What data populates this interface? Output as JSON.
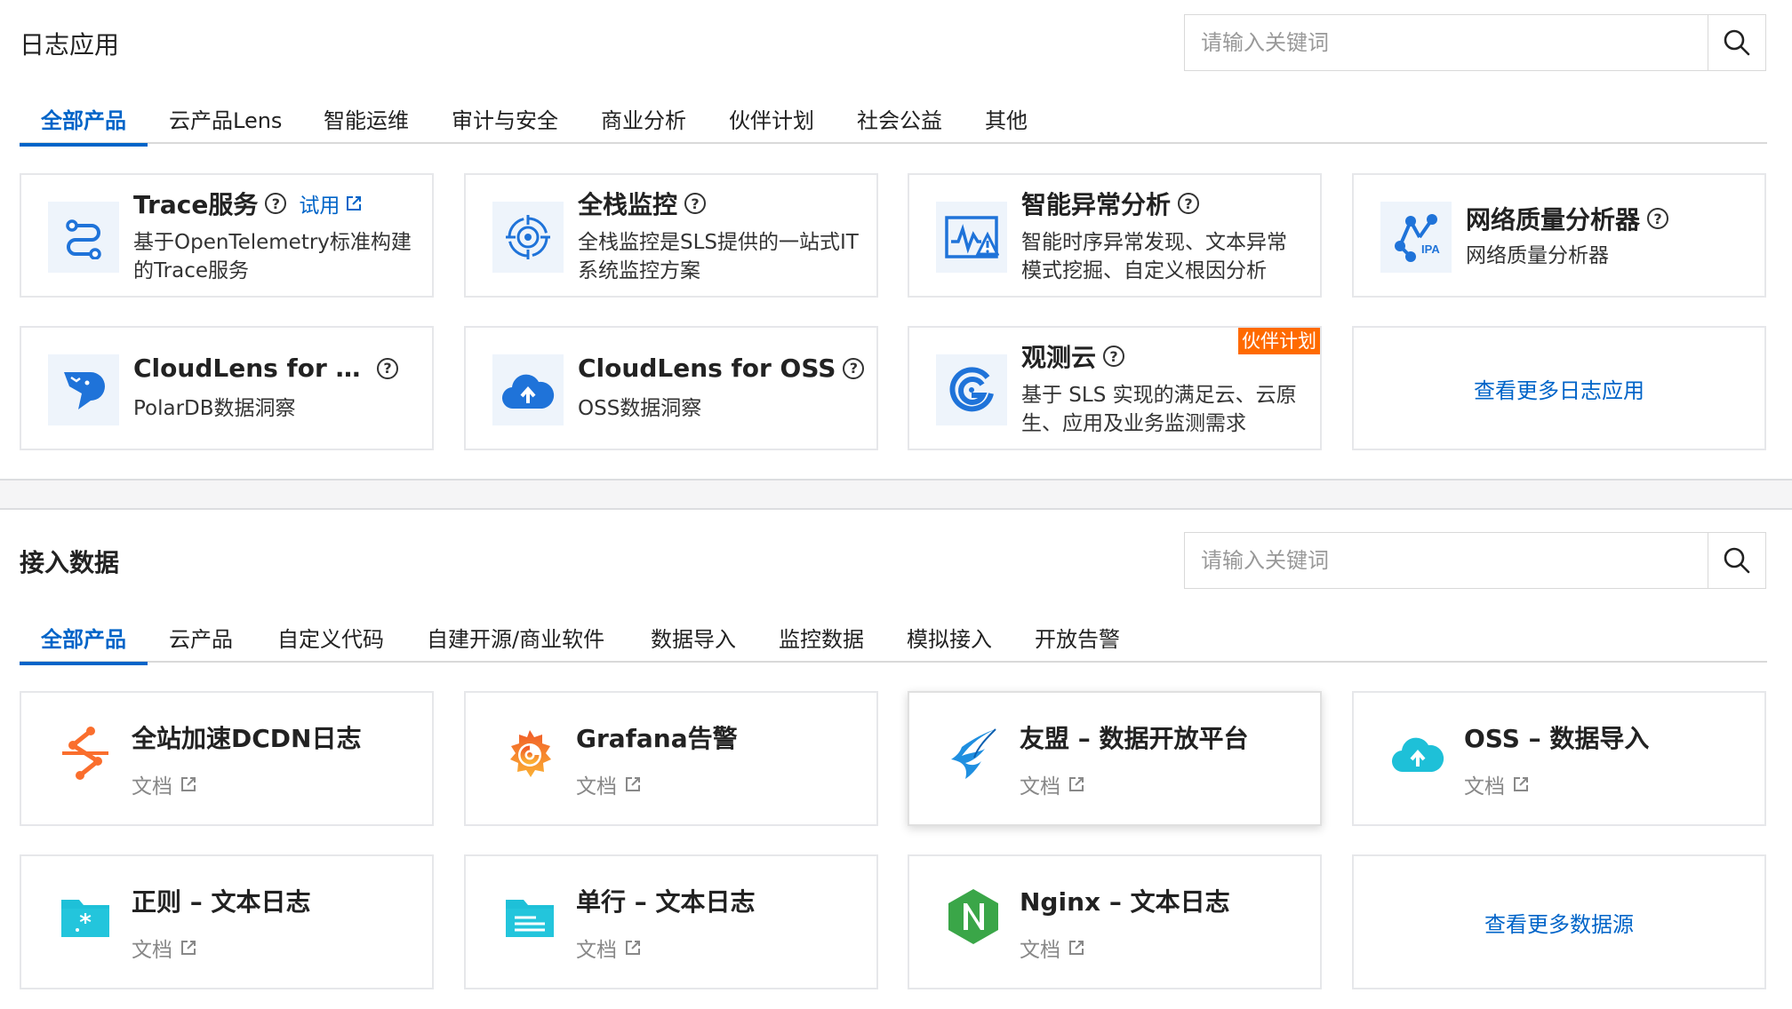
{
  "log_apps": {
    "title": "日志应用",
    "search_placeholder": "请输入关键词",
    "tabs": [
      "全部产品",
      "云产品Lens",
      "智能运维",
      "审计与安全",
      "商业分析",
      "伙伴计划",
      "社会公益",
      "其他"
    ],
    "active_tab": 0,
    "cards": [
      {
        "title": "Trace服务",
        "trial": "试用",
        "desc": "基于OpenTelemetry标准构建的Trace服务",
        "icon": "trace-icon"
      },
      {
        "title": "全栈监控",
        "desc": "全栈监控是SLS提供的一站式IT系统监控方案",
        "icon": "fullstack-monitor-icon"
      },
      {
        "title": "智能异常分析",
        "desc": "智能时序异常发现、文本异常模式挖掘、自定义根因分析",
        "icon": "anomaly-analysis-icon"
      },
      {
        "title": "网络质量分析器",
        "desc": "网络质量分析器",
        "icon": "ipa-network-icon"
      },
      {
        "title": "CloudLens for PolarDB",
        "desc": "PolarDB数据洞察",
        "icon": "polardb-bear-icon"
      },
      {
        "title": "CloudLens for OSS",
        "desc": "OSS数据洞察",
        "icon": "oss-cloud-icon"
      },
      {
        "title": "观测云",
        "badge": "伙伴计划",
        "desc": "基于 SLS 实现的满足云、云原生、应用及业务监测需求",
        "icon": "guance-logo-icon"
      }
    ],
    "more_label": "查看更多日志应用"
  },
  "data_sources": {
    "title": "接入数据",
    "search_placeholder": "请输入关键词",
    "tabs": [
      "全部产品",
      "云产品",
      "自定义代码",
      "自建开源/商业软件",
      "数据导入",
      "监控数据",
      "模拟接入",
      "开放告警"
    ],
    "active_tab": 0,
    "cards": [
      {
        "title": "全站加速DCDN日志",
        "doc": "文档",
        "icon": "dcdn-icon"
      },
      {
        "title": "Grafana告警",
        "doc": "文档",
        "icon": "grafana-icon"
      },
      {
        "title": "友盟 – 数据开放平台",
        "doc": "文档",
        "icon": "umeng-icon"
      },
      {
        "title": "OSS – 数据导入",
        "doc": "文档",
        "icon": "oss-cloud-icon"
      },
      {
        "title": "正则 – 文本日志",
        "doc": "文档",
        "icon": "regex-folder-icon"
      },
      {
        "title": "单行 – 文本日志",
        "doc": "文档",
        "icon": "singleline-folder-icon"
      },
      {
        "title": "Nginx – 文本日志",
        "doc": "文档",
        "icon": "nginx-icon"
      }
    ],
    "more_label": "查看更多数据源"
  },
  "colors": {
    "accent": "#0064c8",
    "partner_badge": "#ff6a00",
    "icon_bg": "#eef4fb",
    "dcdn": "#fa6e2d",
    "nginx": "#3aa648",
    "teal": "#1ec0d8"
  }
}
